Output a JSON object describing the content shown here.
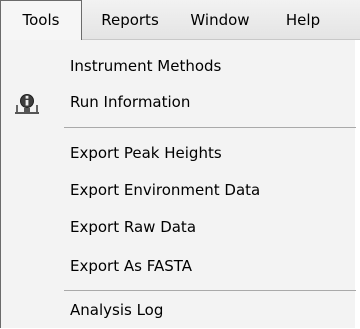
{
  "menubar": {
    "items": [
      {
        "label": "Tools"
      },
      {
        "label": "Reports"
      },
      {
        "label": "Window"
      },
      {
        "label": "Help"
      }
    ]
  },
  "tools_menu": {
    "items": [
      {
        "label": "Instrument Methods",
        "icon": null
      },
      {
        "label": "Run Information",
        "icon": "run-information-icon"
      },
      {
        "label": "Export Peak Heights",
        "icon": null
      },
      {
        "label": "Export Environment Data",
        "icon": null
      },
      {
        "label": "Export Raw Data",
        "icon": null
      },
      {
        "label": "Export As FASTA",
        "icon": null
      },
      {
        "label": "Analysis Log",
        "icon": null
      }
    ]
  }
}
